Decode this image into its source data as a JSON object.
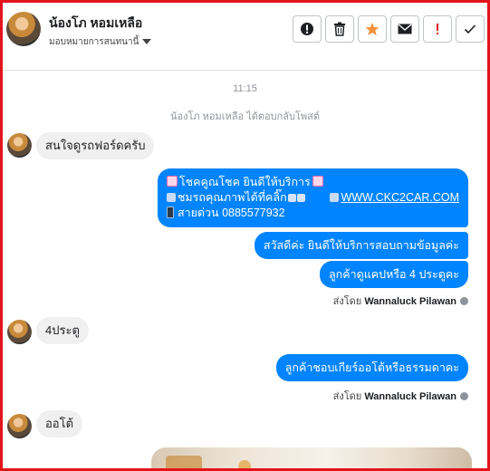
{
  "header": {
    "name": "น้องโภ หอมเหลือ",
    "assign_label": "มอบหมายการสนทนานี้"
  },
  "actions": [
    {
      "name": "report-info-button",
      "icon": "alert-circle-icon"
    },
    {
      "name": "delete-button",
      "icon": "trash-icon"
    },
    {
      "name": "star-button",
      "icon": "star-icon",
      "color": "#f7923b"
    },
    {
      "name": "mark-unread-button",
      "icon": "envelope-icon"
    },
    {
      "name": "follow-up-button",
      "icon": "exclamation-icon",
      "color": "#e3141b"
    },
    {
      "name": "mark-done-button",
      "icon": "checkmark-icon"
    }
  ],
  "thread": {
    "time": "11:15",
    "reply_notice": "น้องโภ หอมเหลือ ได้ตอบกลับโพสต์",
    "m1": "สนใจดูรถฟอร์ดครับ",
    "out1_line1": "โชคคูณโชค ยินดีให้บริการ",
    "out1_line2a": "ชมรถคุณภาพได้ที่คลิ๊ก",
    "out1_link": "WWW.CKC2CAR.COM",
    "out1_line3": "สายด่วน 0885577932",
    "out2": "สวัสดีค่ะ  ยินดีให้บริการสอบถามข้อมูลค่ะ",
    "out3": "ลูกค้าดูแคปหรือ 4 ประตูคะ",
    "sent_prefix": "ส่งโดย",
    "sender": "Wannaluck Pilawan",
    "m2": "4ประตู",
    "out4": "ลูกค้าชอบเกียร์ออโต้หรือธรรมดาคะ",
    "m3": "ออโต้"
  }
}
